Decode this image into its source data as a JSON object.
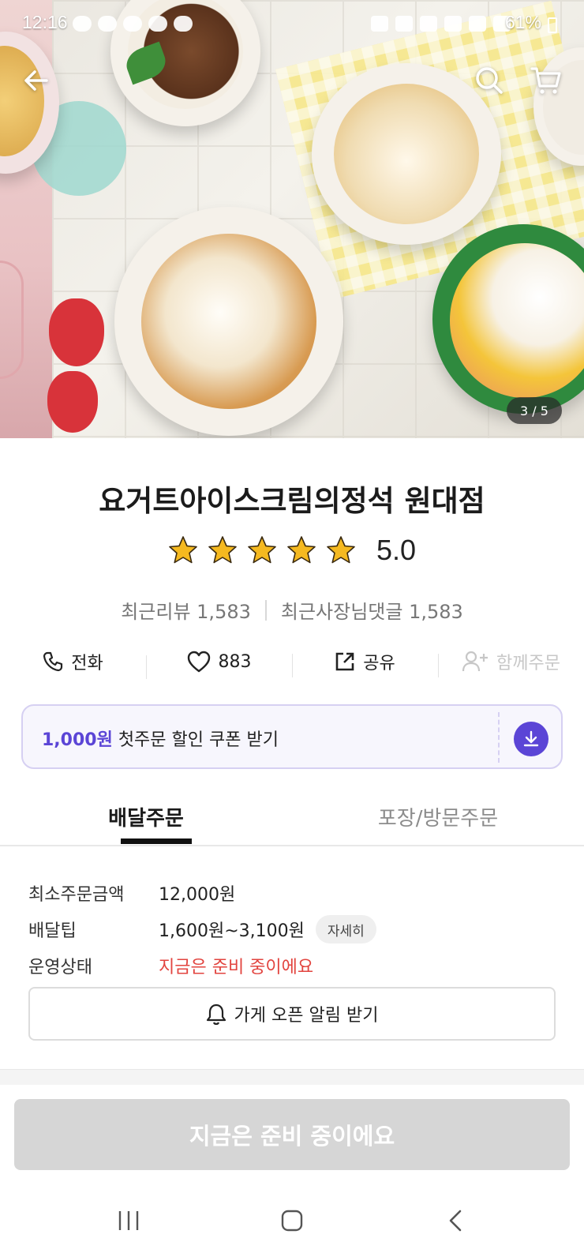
{
  "status_bar": {
    "time": "12:16",
    "battery": "61%"
  },
  "hero": {
    "image_counter": "3 / 5"
  },
  "store": {
    "name": "요거트아이스크림의정석 원대점",
    "rating": "5.0",
    "star_count": 5,
    "recent_reviews": "최근리뷰 1,583",
    "recent_owner_replies": "최근사장님댓글 1,583"
  },
  "actions": [
    {
      "label": "전화",
      "icon": "phone-icon"
    },
    {
      "label": "883",
      "icon": "heart-icon"
    },
    {
      "label": "공유",
      "icon": "share-icon"
    },
    {
      "label": "함께주문",
      "icon": "add-user-icon"
    }
  ],
  "coupon": {
    "amount": "1,000원",
    "text": " 첫주문 할인 쿠폰 받기"
  },
  "tabs": [
    "배달주문",
    "포장/방문주문"
  ],
  "delivery_info": {
    "min_order_label": "최소주문금액",
    "min_order_value": "12,000원",
    "tip_label": "배달팁",
    "tip_value": "1,600원~3,100원",
    "tip_detail": "자세히",
    "status_label": "운영상태",
    "status_value": "지금은 준비 중이에요"
  },
  "notify_button": "가게 오픈 알림 받기",
  "order_button": "지금은 준비 중이에요",
  "colors": {
    "accent": "#5b45d6",
    "alert": "#e2443f",
    "star": "#f5b920",
    "disabled": "#d6d6d6"
  }
}
